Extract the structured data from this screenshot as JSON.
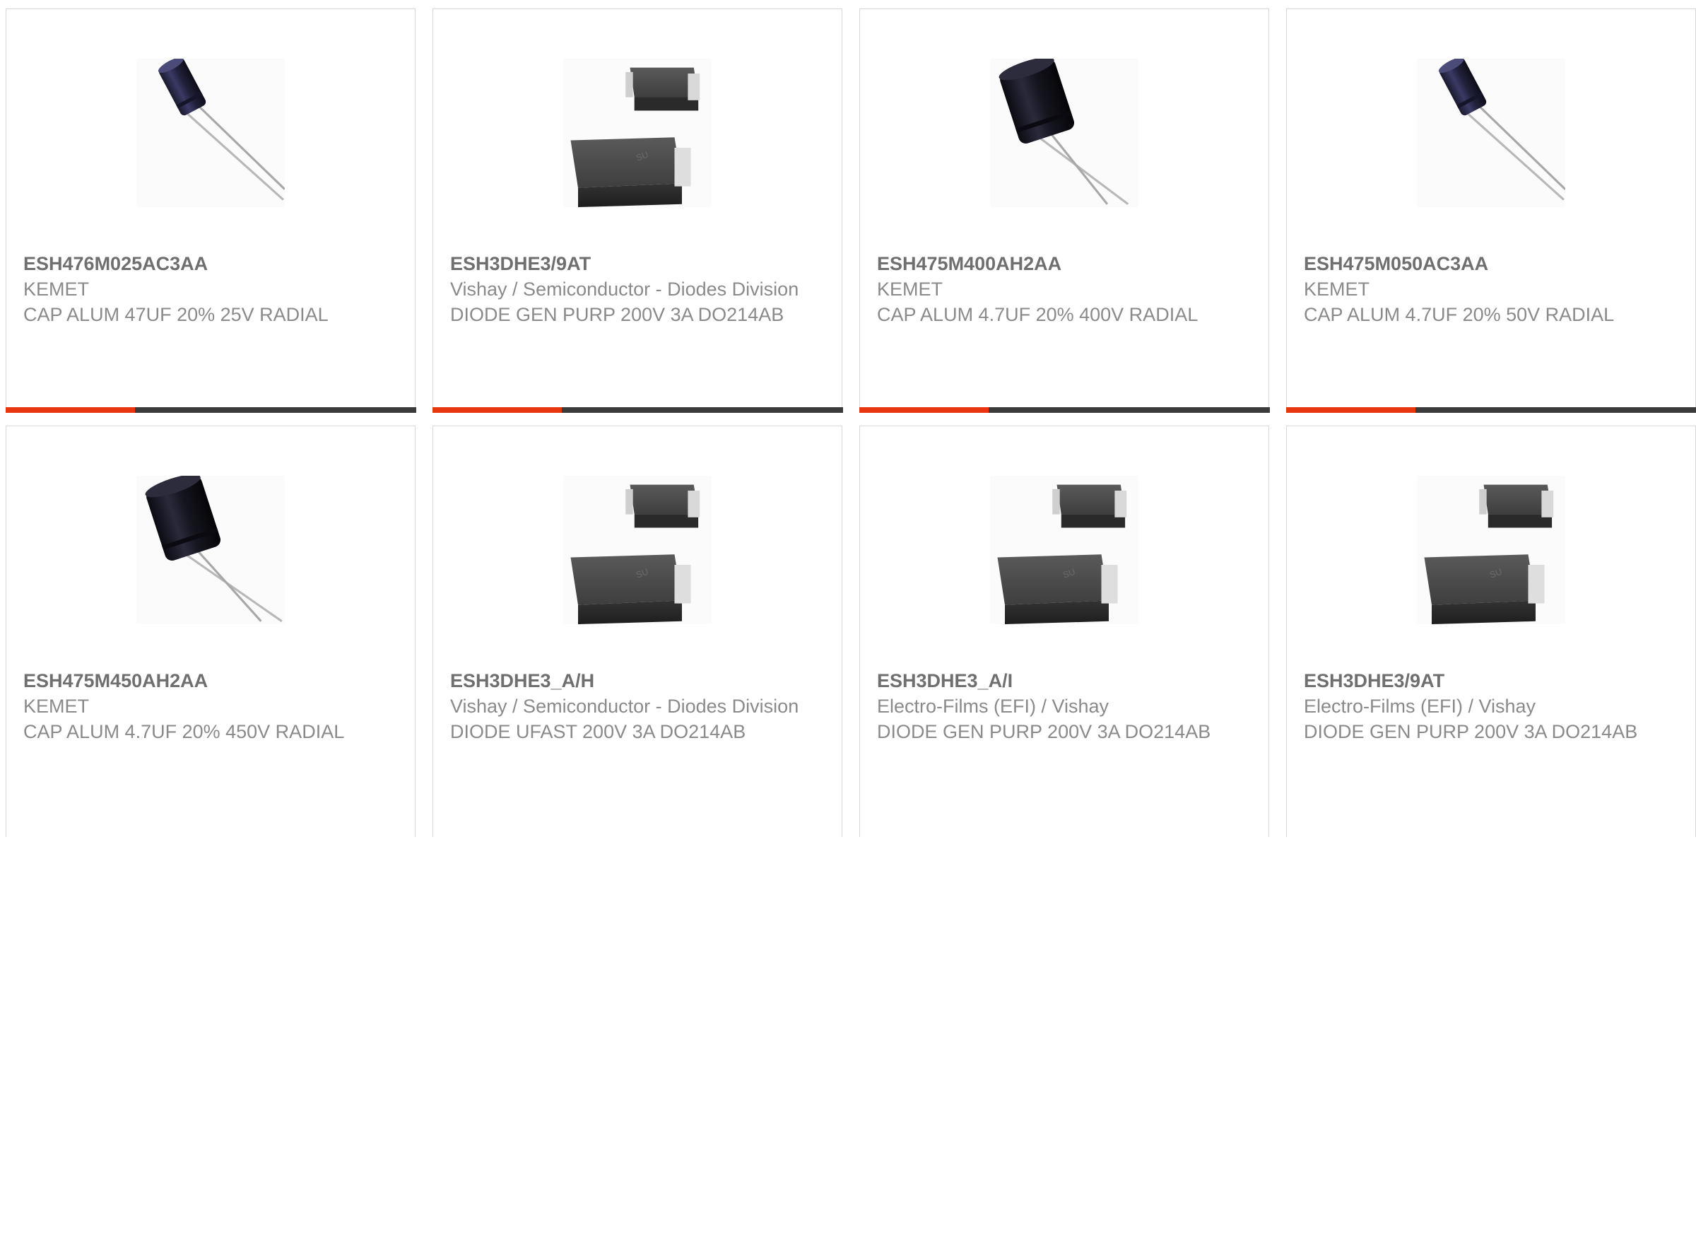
{
  "colors": {
    "accent": "#e8360e",
    "bar_dark": "#3b3b3b",
    "card_border": "#d8d8d8",
    "text_primary": "#6f6f6f",
    "text_secondary": "#8a8a8a"
  },
  "products": [
    {
      "part_number": "ESH476M025AC3AA",
      "manufacturer": "KEMET",
      "description": "CAP ALUM 47UF 20% 25V RADIAL",
      "image": "radial-capacitor-thin-icon"
    },
    {
      "part_number": "ESH3DHE3/9AT",
      "manufacturer": "Vishay / Semiconductor - Diodes Division",
      "description": "DIODE GEN PURP 200V 3A DO214AB",
      "image": "smd-diode-package-icon"
    },
    {
      "part_number": "ESH475M400AH2AA",
      "manufacturer": "KEMET",
      "description": "CAP ALUM 4.7UF 20% 400V RADIAL",
      "image": "radial-capacitor-wide-icon"
    },
    {
      "part_number": "ESH475M050AC3AA",
      "manufacturer": "KEMET",
      "description": "CAP ALUM 4.7UF 20% 50V RADIAL",
      "image": "radial-capacitor-thin-icon"
    },
    {
      "part_number": "ESH475M450AH2AA",
      "manufacturer": "KEMET",
      "description": "CAP ALUM 4.7UF 20% 450V RADIAL",
      "image": "radial-capacitor-wide-icon"
    },
    {
      "part_number": "ESH3DHE3_A/H",
      "manufacturer": "Vishay / Semiconductor - Diodes Division",
      "description": "DIODE UFAST 200V 3A DO214AB",
      "image": "smd-diode-package-icon"
    },
    {
      "part_number": "ESH3DHE3_A/I",
      "manufacturer": "Electro-Films (EFI) / Vishay",
      "description": "DIODE GEN PURP 200V 3A DO214AB",
      "image": "smd-diode-package-icon"
    },
    {
      "part_number": "ESH3DHE3/9AT",
      "manufacturer": "Electro-Films (EFI) / Vishay",
      "description": "DIODE GEN PURP 200V 3A DO214AB",
      "image": "smd-diode-package-icon"
    }
  ]
}
